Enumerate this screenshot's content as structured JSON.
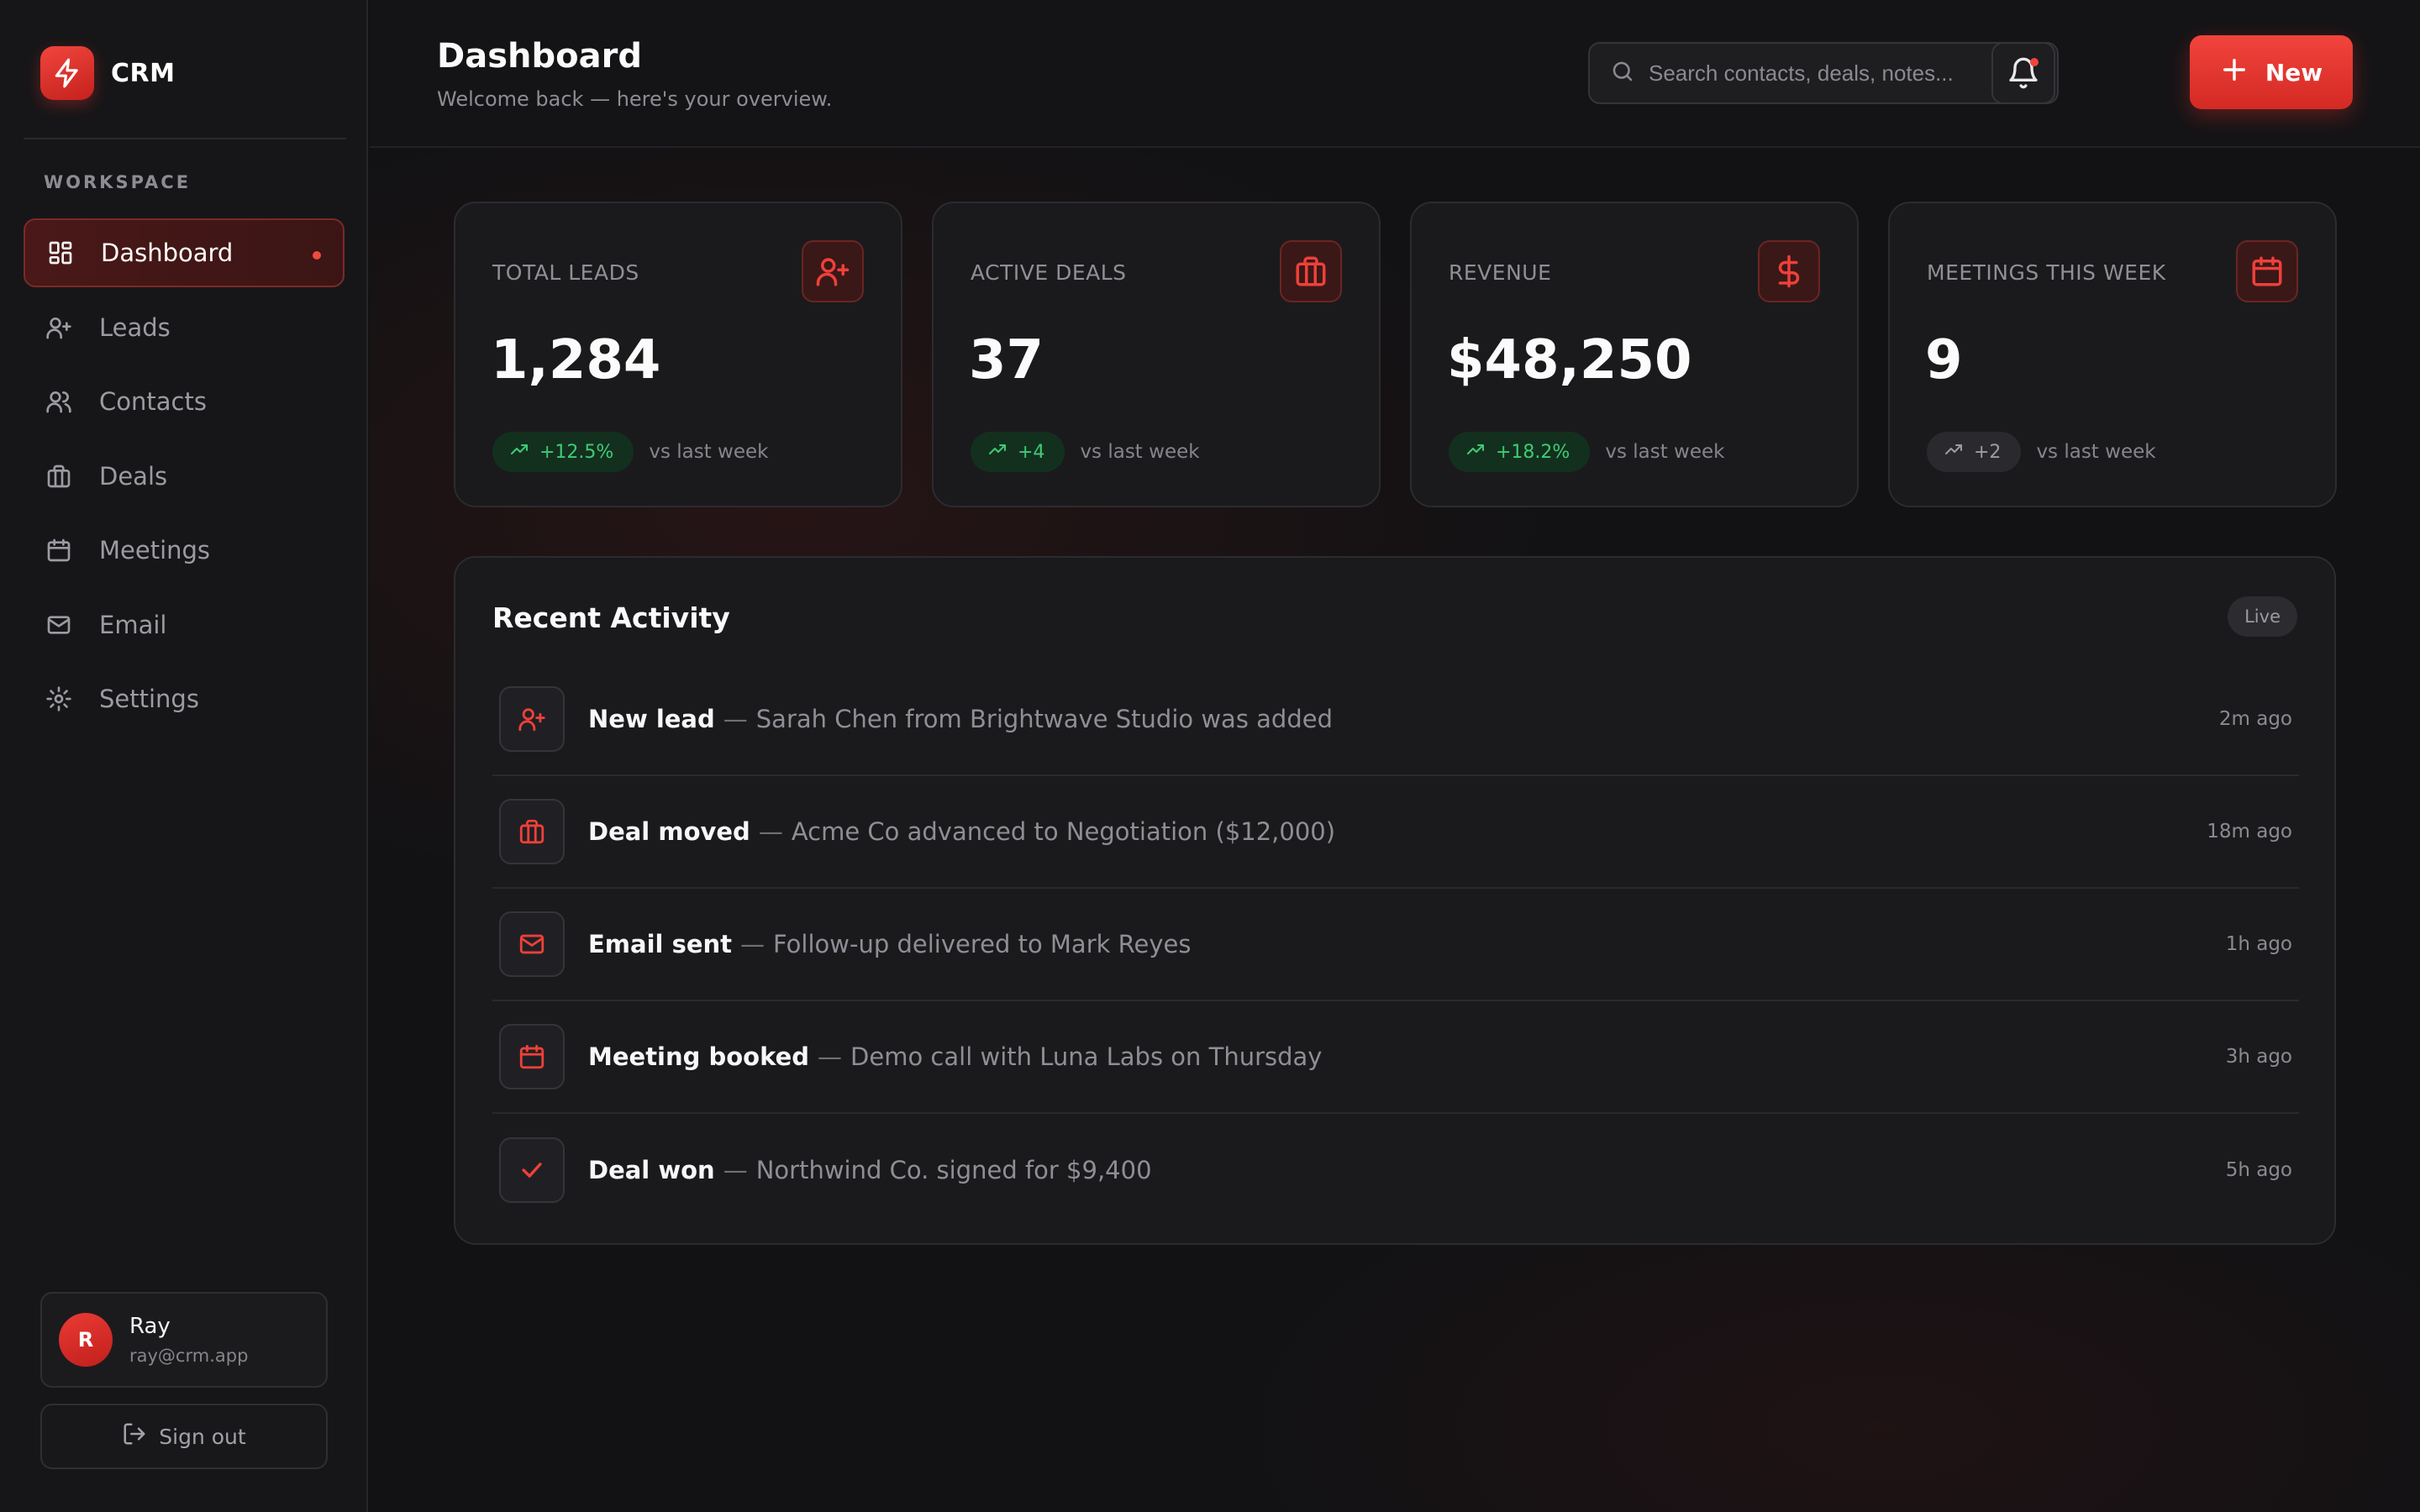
{
  "app": {
    "name": "CRM"
  },
  "sidebar": {
    "section_label": "WORKSPACE",
    "items": [
      {
        "label": "Dashboard",
        "icon": "layout-grid-icon",
        "active": true
      },
      {
        "label": "Leads",
        "icon": "user-plus-icon"
      },
      {
        "label": "Contacts",
        "icon": "users-icon"
      },
      {
        "label": "Deals",
        "icon": "briefcase-icon"
      },
      {
        "label": "Meetings",
        "icon": "calendar-icon"
      },
      {
        "label": "Email",
        "icon": "mail-icon"
      },
      {
        "label": "Settings",
        "icon": "gear-icon"
      }
    ],
    "user": {
      "initial": "R",
      "name": "Ray",
      "email": "ray@crm.app"
    },
    "sign_out_label": "Sign out"
  },
  "header": {
    "title": "Dashboard",
    "subtitle": "Welcome back — here's your overview.",
    "search_placeholder": "Search contacts, deals, notes...",
    "new_button_label": "New"
  },
  "stats": [
    {
      "label": "TOTAL LEADS",
      "value": "1,284",
      "delta": "+12.5%",
      "trend": "up",
      "compare": "vs last week",
      "icon": "user-plus-icon"
    },
    {
      "label": "ACTIVE DEALS",
      "value": "37",
      "delta": "+4",
      "trend": "up",
      "compare": "vs last week",
      "icon": "briefcase-icon"
    },
    {
      "label": "REVENUE",
      "value": "$48,250",
      "delta": "+18.2%",
      "trend": "up",
      "compare": "vs last week",
      "icon": "dollar-icon"
    },
    {
      "label": "MEETINGS THIS WEEK",
      "value": "9",
      "delta": "+2",
      "trend": "neutral",
      "compare": "vs last week",
      "icon": "calendar-icon"
    }
  ],
  "activity": {
    "title": "Recent Activity",
    "badge": "Live",
    "items": [
      {
        "title": "New lead",
        "separator": "—",
        "detail": "Sarah Chen from Brightwave Studio was added",
        "time": "2m ago",
        "icon": "user-plus-icon"
      },
      {
        "title": "Deal moved",
        "separator": "—",
        "detail": "Acme Co advanced to Negotiation ($12,000)",
        "time": "18m ago",
        "icon": "briefcase-icon"
      },
      {
        "title": "Email sent",
        "separator": "—",
        "detail": "Follow-up delivered to Mark Reyes",
        "time": "1h ago",
        "icon": "mail-icon"
      },
      {
        "title": "Meeting booked",
        "separator": "—",
        "detail": "Demo call with Luna Labs on Thursday",
        "time": "3h ago",
        "icon": "calendar-icon"
      },
      {
        "title": "Deal won",
        "separator": "—",
        "detail": "Northwind Co. signed for $9,400",
        "time": "5h ago",
        "icon": "check-icon"
      }
    ]
  },
  "colors": {
    "accent": "#ef4039",
    "positive": "#3ecb74",
    "background": "#121214",
    "surface": "#1a1a1d"
  }
}
